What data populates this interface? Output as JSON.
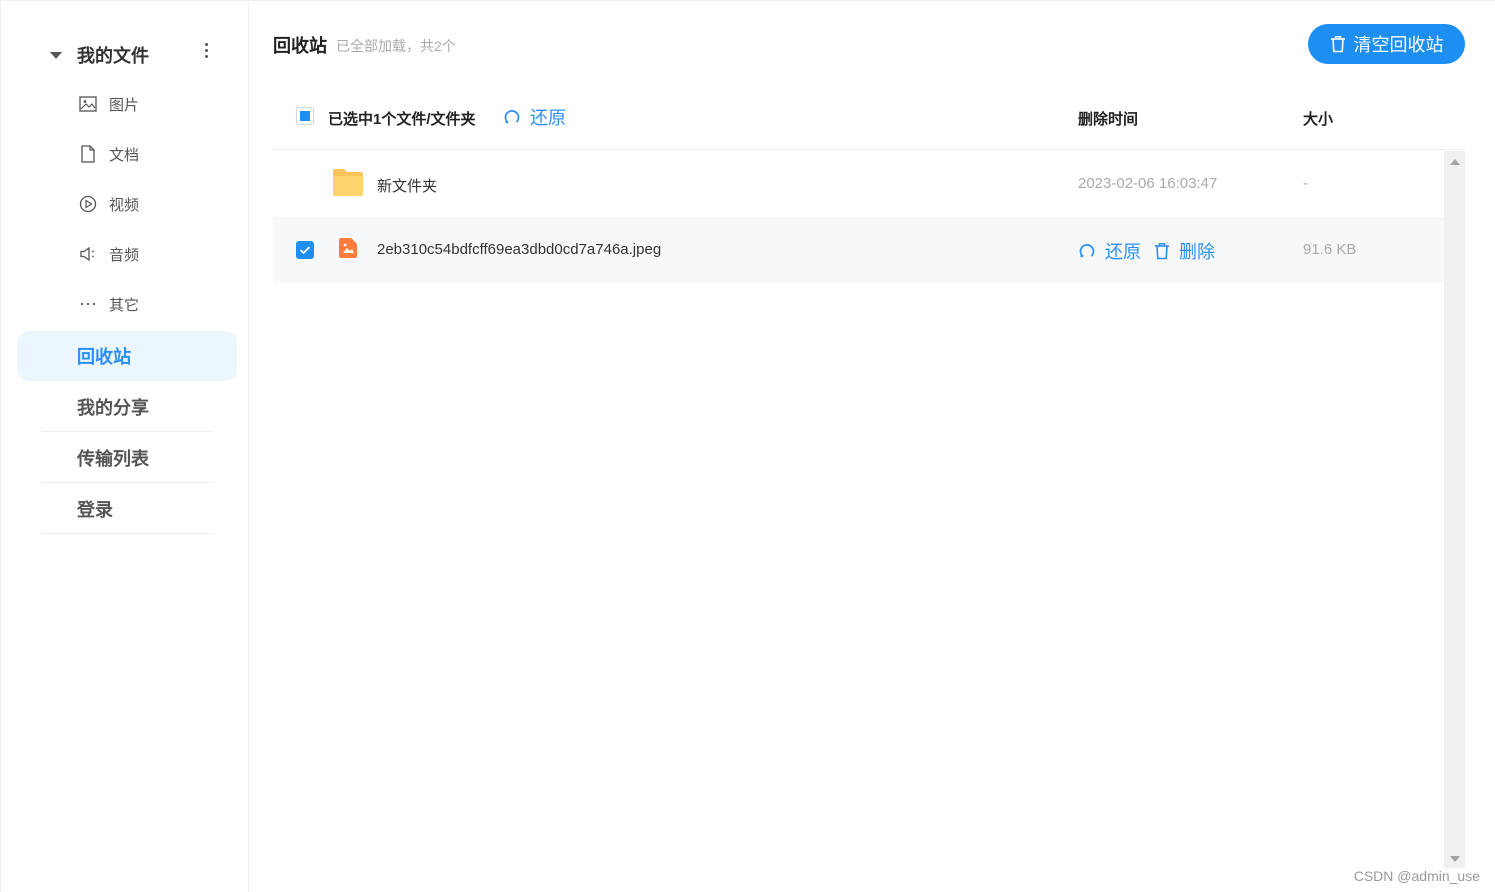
{
  "sidebar": {
    "group_label": "我的文件",
    "sub_items": [
      {
        "label": "图片",
        "icon": "image-icon"
      },
      {
        "label": "文档",
        "icon": "document-icon"
      },
      {
        "label": "视频",
        "icon": "video-icon"
      },
      {
        "label": "音频",
        "icon": "audio-icon"
      },
      {
        "label": "其它",
        "icon": "more-icon"
      }
    ],
    "nav": [
      {
        "label": "回收站",
        "active": true
      },
      {
        "label": "我的分享"
      },
      {
        "label": "传输列表"
      },
      {
        "label": "登录"
      }
    ]
  },
  "main": {
    "title": "回收站",
    "subtitle": "已全部加载，共2个",
    "clear_button": "清空回收站",
    "header": {
      "selected_label": "已选中1个文件/文件夹",
      "restore_label": "还原",
      "col_deleted_time": "删除时间",
      "col_size": "大小"
    },
    "rows": [
      {
        "name": "新文件夹",
        "date": "2023-02-06 16:03:47",
        "size": "-",
        "checked": false
      },
      {
        "name": "2eb310c54bdfcff69ea3dbd0cd7a746a.jpeg",
        "restore": "还原",
        "delete": "删除",
        "size": "91.6 KB",
        "checked": true
      }
    ]
  },
  "watermark": "CSDN @admin_use",
  "colors": {
    "accent": "#1d8ef2",
    "folder": "#fcc45a",
    "image_file": "#ff7d3c"
  }
}
